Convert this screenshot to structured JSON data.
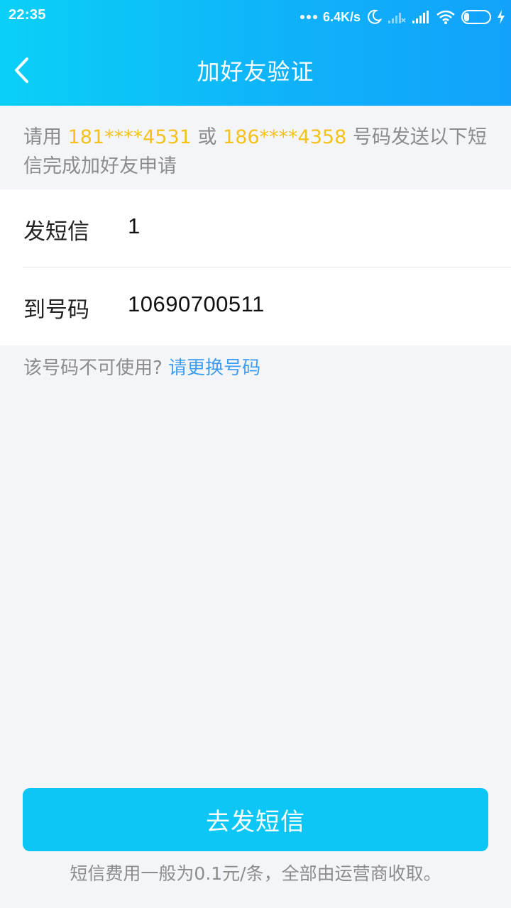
{
  "status_bar": {
    "time": "22:35",
    "net_speed": "6.4K/s",
    "battery_level": "29",
    "battery_fraction": 0.29,
    "icons": [
      "dots-icon",
      "moon-icon",
      "signal-x-icon",
      "signal-icon",
      "wifi-icon",
      "battery-icon",
      "charging-icon"
    ]
  },
  "nav": {
    "title": "加好友验证",
    "back_icon": "chevron-left-icon"
  },
  "notice": {
    "prefix": "请用 ",
    "phone1": "181****4531",
    "mid": " 或 ",
    "phone2": "186****4358",
    "suffix": " 号码发送以下短信完成加好友申请"
  },
  "details": {
    "rows": [
      {
        "label": "发短信",
        "value": "1"
      },
      {
        "label": "到号码",
        "value": "10690700511"
      }
    ]
  },
  "hint": {
    "text": "该号码不可使用? ",
    "link": "请更换号码"
  },
  "action": {
    "send_label": "去发短信",
    "fee_note": "短信费用一般为0.1元/条，全部由运营商收取。"
  },
  "colors": {
    "header_start": "#0ad0f7",
    "header_end": "#12a2fb",
    "highlight": "#f5c219",
    "link": "#3d9cf0",
    "button": "#0cc6f5"
  }
}
